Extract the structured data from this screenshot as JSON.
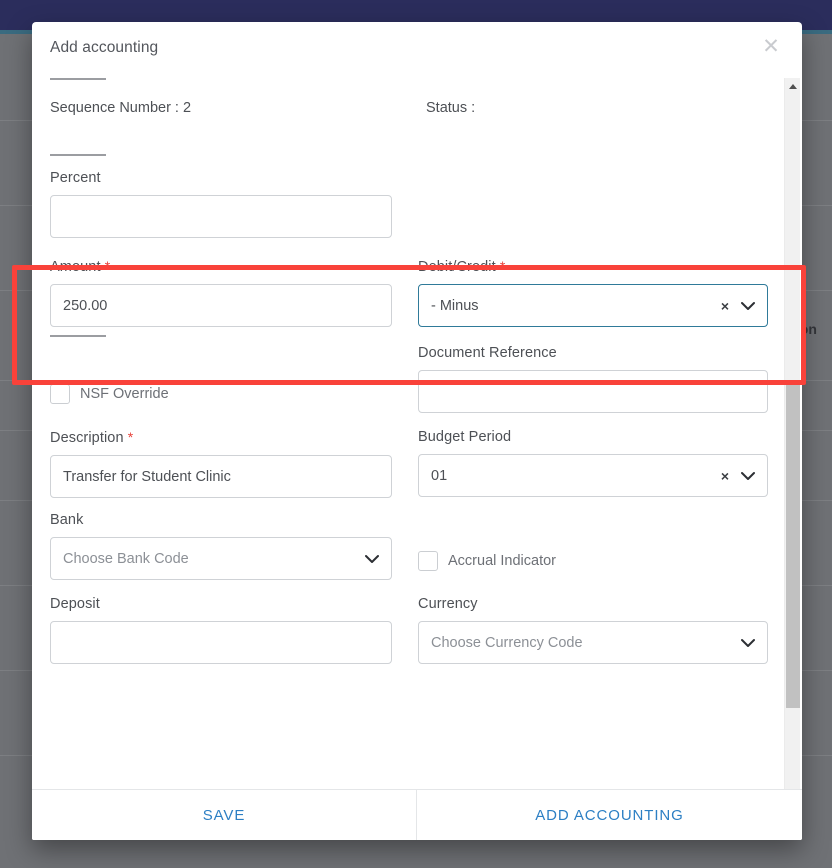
{
  "background": {
    "app_bar_color": "#2b2d5c",
    "accent_color": "#3a6b80",
    "partial_text": "ization"
  },
  "modal": {
    "title": "Add accounting",
    "close_icon": "close-icon",
    "meta": {
      "sequence_label": "Sequence Number : 2",
      "status_label": "Status :"
    },
    "fields": {
      "percent": {
        "label": "Percent",
        "value": "",
        "placeholder": ""
      },
      "amount": {
        "label": "Amount",
        "required": "*",
        "value": "250.00"
      },
      "debit_credit": {
        "label": "Debit/Credit",
        "required": "*",
        "value": "- Minus",
        "clear_icon": "×",
        "chevron_icon": "chevron-down-icon"
      },
      "nsf_override": {
        "label": "NSF Override",
        "checked": false
      },
      "document_reference": {
        "label": "Document Reference",
        "value": ""
      },
      "description": {
        "label": "Description",
        "required": "*",
        "value": "Transfer for Student Clinic"
      },
      "budget_period": {
        "label": "Budget Period",
        "value": "01",
        "clear_icon": "×",
        "chevron_icon": "chevron-down-icon"
      },
      "bank": {
        "label": "Bank",
        "value": "",
        "placeholder": "Choose Bank Code",
        "chevron_icon": "chevron-down-icon"
      },
      "accrual_indicator": {
        "label": "Accrual Indicator",
        "checked": false
      },
      "deposit": {
        "label": "Deposit",
        "value": ""
      },
      "currency": {
        "label": "Currency",
        "value": "",
        "placeholder": "Choose Currency Code",
        "chevron_icon": "chevron-down-icon"
      }
    },
    "footer": {
      "save_label": "SAVE",
      "add_accounting_label": "ADD ACCOUNTING"
    }
  },
  "scrollbar": {
    "up_icon": "caret-up-icon",
    "down_icon": "caret-down-icon"
  },
  "annotation": {
    "color": "#f9423a"
  }
}
